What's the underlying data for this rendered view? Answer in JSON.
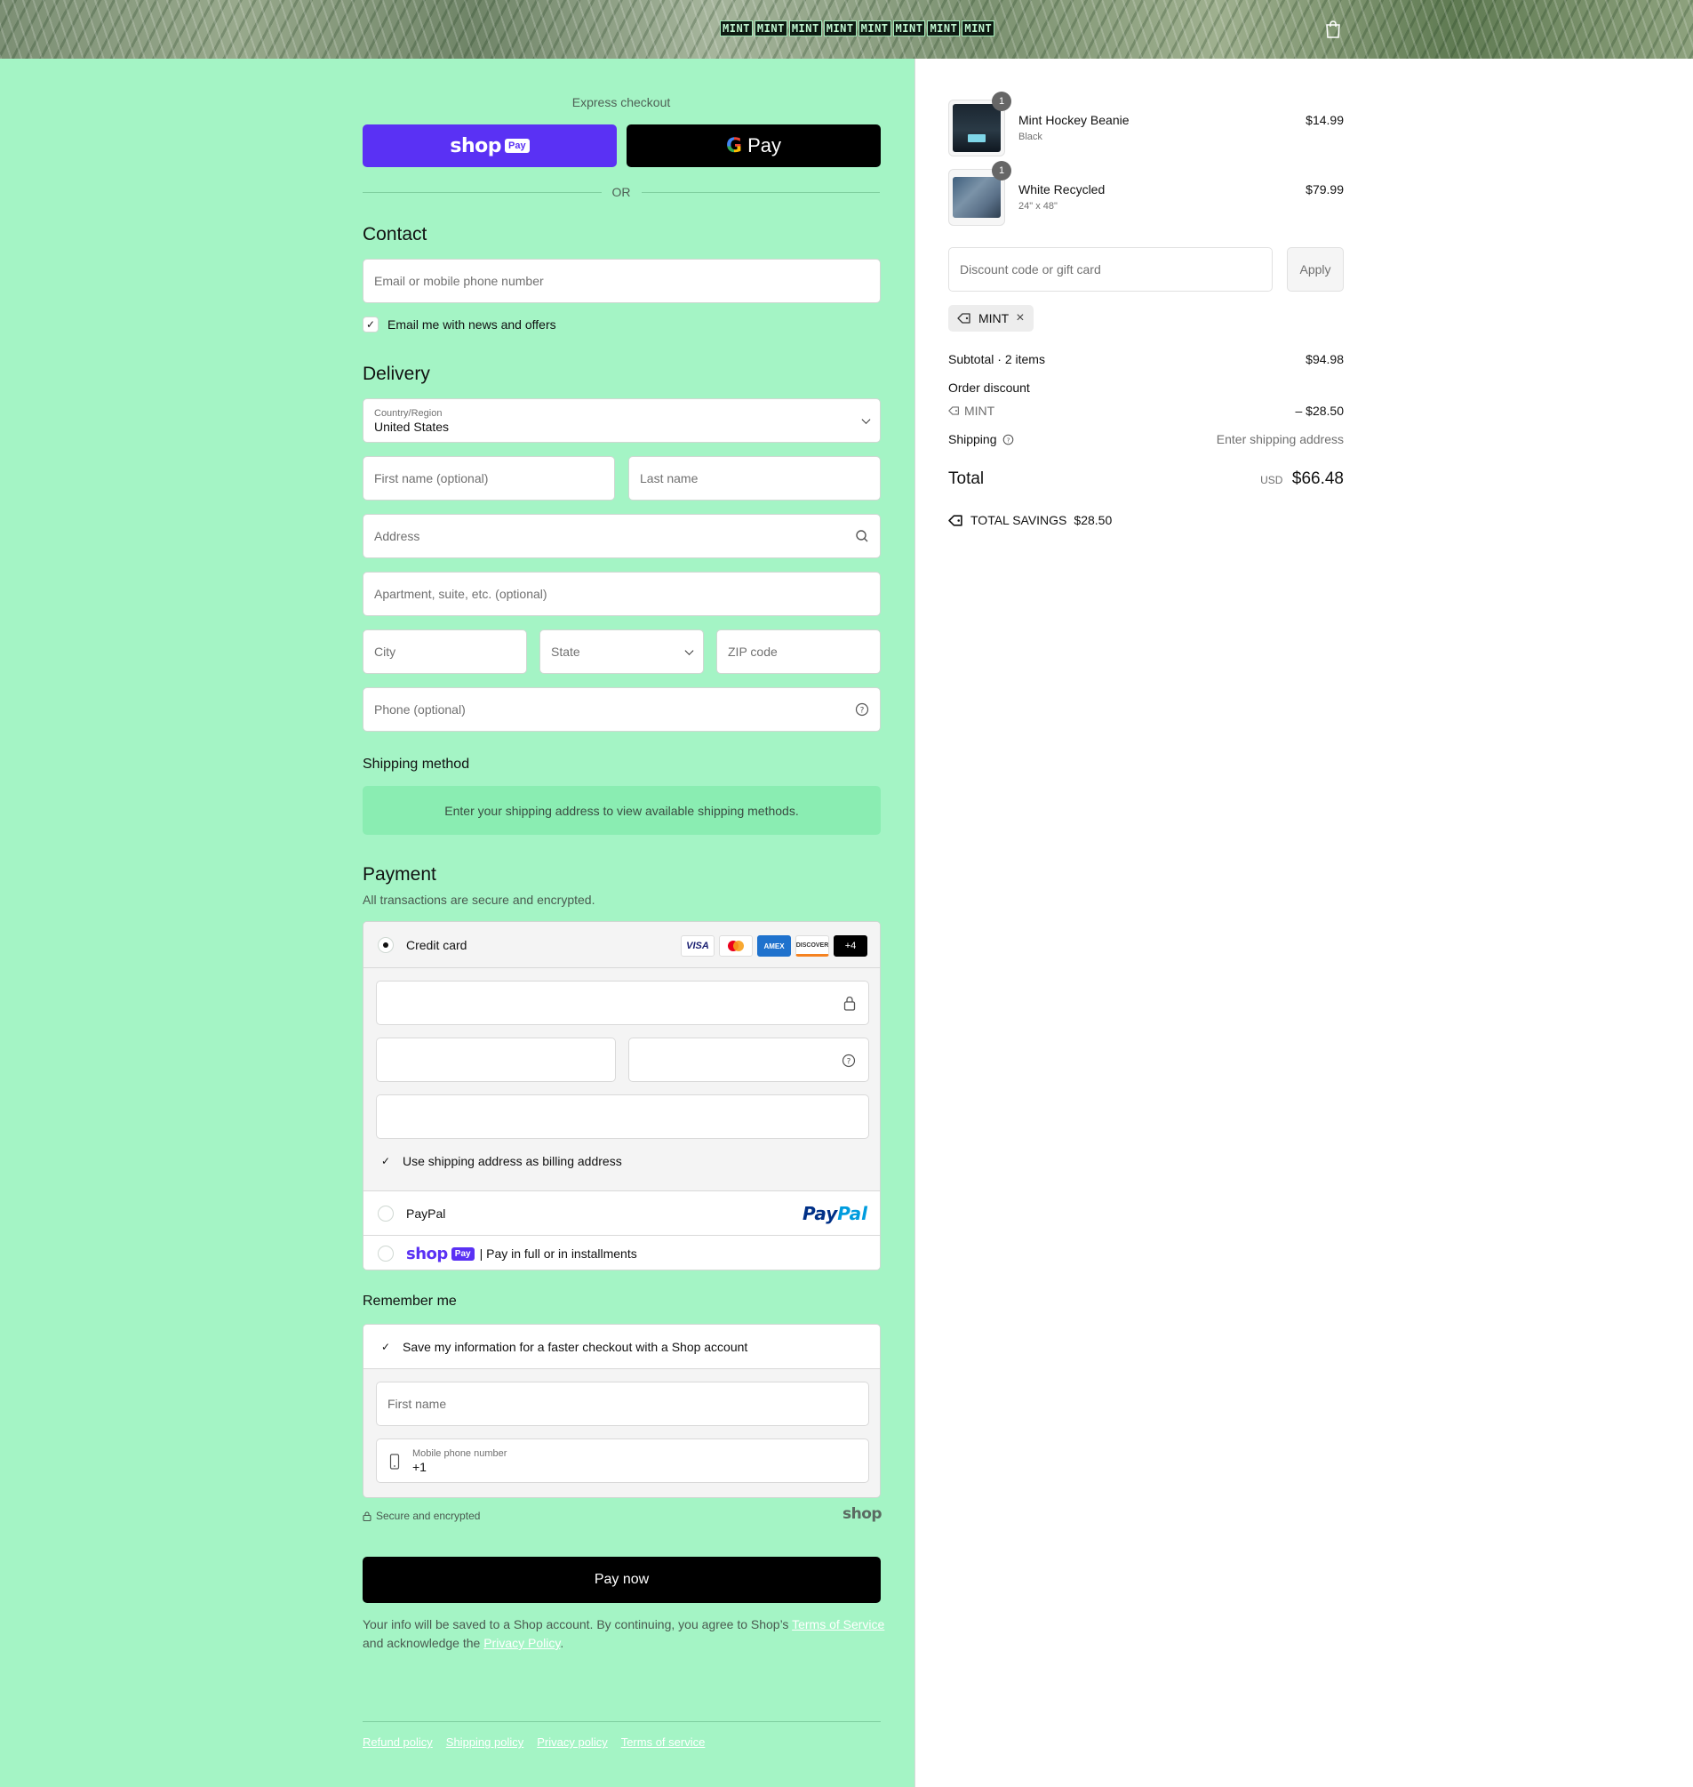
{
  "header": {
    "logo_tiles": [
      "MINT",
      "MINT",
      "MINT",
      "MINT",
      "MINT",
      "MINT",
      "MINT",
      "MINT"
    ],
    "cart_icon": "shopping-bag-icon"
  },
  "express": {
    "label": "Express checkout",
    "shop_pay": "shop",
    "shop_pay_chip": "Pay",
    "google_pay": "Pay",
    "or": "OR"
  },
  "contact": {
    "title": "Contact",
    "email_placeholder": "Email or mobile phone number",
    "news_label": "Email me with news and offers",
    "news_checked": true
  },
  "delivery": {
    "title": "Delivery",
    "country_label": "Country/Region",
    "country_value": "United States",
    "first_name": "First name (optional)",
    "last_name": "Last name",
    "address": "Address",
    "apartment": "Apartment, suite, etc. (optional)",
    "city": "City",
    "state": "State",
    "zip": "ZIP code",
    "phone": "Phone (optional)"
  },
  "shipping_method": {
    "title": "Shipping method",
    "info": "Enter your shipping address to view available shipping methods."
  },
  "payment": {
    "title": "Payment",
    "subtitle": "All transactions are secure and encrypted.",
    "credit_card": "Credit card",
    "cards": [
      "VISA",
      "AMEX",
      "DISCOVER",
      "+4"
    ],
    "billing_same": "Use shipping address as billing address",
    "paypal": "PayPal",
    "paypal_logo_1": "Pay",
    "paypal_logo_2": "Pal",
    "shoppay_word": "shop",
    "shoppay_chip": "Pay",
    "shoppay_text": "| Pay in full or in installments"
  },
  "remember": {
    "title": "Remember me",
    "save_label": "Save my information for a faster checkout with a Shop account",
    "first_name": "First name",
    "mobile_label": "Mobile phone number",
    "mobile_value": "+1",
    "secure": "Secure and encrypted",
    "shop_mark": "shop"
  },
  "pay_now": "Pay now",
  "legal": {
    "text1": "Your info will be saved to a Shop account. By continuing, you agree to Shop’s ",
    "tos": "Terms of Service",
    "text2": "and acknowledge the ",
    "privacy": "Privacy Policy",
    "text3": "."
  },
  "footer": [
    "Refund policy",
    "Shipping policy",
    "Privacy policy",
    "Terms of service"
  ],
  "cart": {
    "items": [
      {
        "name": "Mint Hockey Beanie",
        "variant": "Black",
        "price": "$14.99",
        "qty": "1"
      },
      {
        "name": "White Recycled",
        "variant": "24\" x 48\"",
        "price": "$79.99",
        "qty": "1"
      }
    ],
    "discount_placeholder": "Discount code or gift card",
    "apply": "Apply",
    "code_chip": "MINT",
    "subtotal_label": "Subtotal · 2 items",
    "subtotal": "$94.98",
    "order_discount": "Order discount",
    "discount_code": "MINT",
    "discount_amount": "– $28.50",
    "shipping_label": "Shipping",
    "shipping_value": "Enter shipping address",
    "total_label": "Total",
    "currency": "USD",
    "total": "$66.48",
    "savings_label": "TOTAL SAVINGS",
    "savings": "$28.50"
  }
}
